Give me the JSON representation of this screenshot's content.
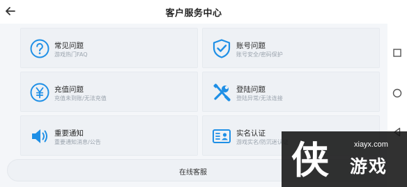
{
  "header": {
    "title": "客户服务中心",
    "back_icon": "arrow-left-icon"
  },
  "cards": [
    {
      "label": "常见问题",
      "sub": "游戏热门FAQ",
      "icon": "question-circle-icon"
    },
    {
      "label": "账号问题",
      "sub": "账号安全/密码保护",
      "icon": "shield-check-icon"
    },
    {
      "label": "充值问题",
      "sub": "充值未到账/无法充值",
      "icon": "yen-circle-icon"
    },
    {
      "label": "登陆问题",
      "sub": "登陆异常/无法连接",
      "icon": "wrench-screwdriver-icon"
    },
    {
      "label": "重要通知",
      "sub": "重要通知消息/公告",
      "icon": "speaker-icon"
    },
    {
      "label": "实名认证",
      "sub": "游戏实名/防沉迷认证",
      "icon": "id-card-icon"
    }
  ],
  "online_service": {
    "label": "在线客服"
  },
  "system_nav": {
    "items": [
      "recent-apps-square-icon",
      "home-circle-icon",
      "back-triangle-icon"
    ]
  },
  "watermark": {
    "url": "xiayx.com",
    "name": "游戏",
    "logo_char": "侠"
  },
  "colors": {
    "accent": "#1e8fe6",
    "card_bg": "#eef1f5",
    "page_bg": "#f4f6f9"
  }
}
